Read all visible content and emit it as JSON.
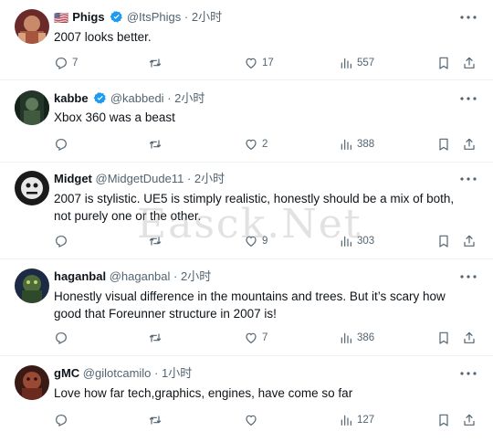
{
  "tweets": [
    {
      "flag": "🇺🇸",
      "name": "Phigs",
      "verified": true,
      "handle": "@ItsPhigs",
      "sep": "·",
      "time": "2小时",
      "text": "2007 looks better.",
      "replies": "7",
      "retweets": "",
      "likes": "17",
      "views": "557"
    },
    {
      "name": "kabbe",
      "verified": true,
      "handle": "@kabbedi",
      "sep": "·",
      "time": "2小时",
      "text": "Xbox 360 was a beast",
      "replies": "",
      "retweets": "",
      "likes": "2",
      "views": "388"
    },
    {
      "name": "Midget",
      "verified": false,
      "handle": "@MidgetDude11",
      "sep": "·",
      "time": "2小时",
      "text": "2007 is stylistic. UE5 is stimply realistic, honestly should be a mix of both, not purely one or the other.",
      "replies": "",
      "retweets": "",
      "likes": "9",
      "views": "303"
    },
    {
      "name": "haganbal",
      "verified": false,
      "handle": "@haganbal",
      "sep": "·",
      "time": "2小时",
      "text": "Honestly visual difference in the mountains and trees. But it’s scary how good that Foreunner structure in 2007 is!",
      "replies": "",
      "retweets": "",
      "likes": "7",
      "views": "386"
    },
    {
      "name": "gMC",
      "verified": false,
      "handle": "@gilotcamilo",
      "sep": "·",
      "time": "1小时",
      "text": "Love how far tech,graphics, engines, have come so far",
      "replies": "",
      "retweets": "",
      "likes": "",
      "views": "127"
    }
  ],
  "watermark": "Easck.Net",
  "icons": {
    "reply": "reply-icon",
    "retweet": "retweet-icon",
    "like": "like-icon",
    "views": "views-icon",
    "bookmark": "bookmark-icon",
    "share": "share-icon",
    "more": "more-icon",
    "verified": "verified-badge-icon"
  },
  "colors": {
    "verified": "#1d9bf0",
    "text": "#0f1419",
    "muted": "#536471",
    "divider": "#eff3f4"
  }
}
